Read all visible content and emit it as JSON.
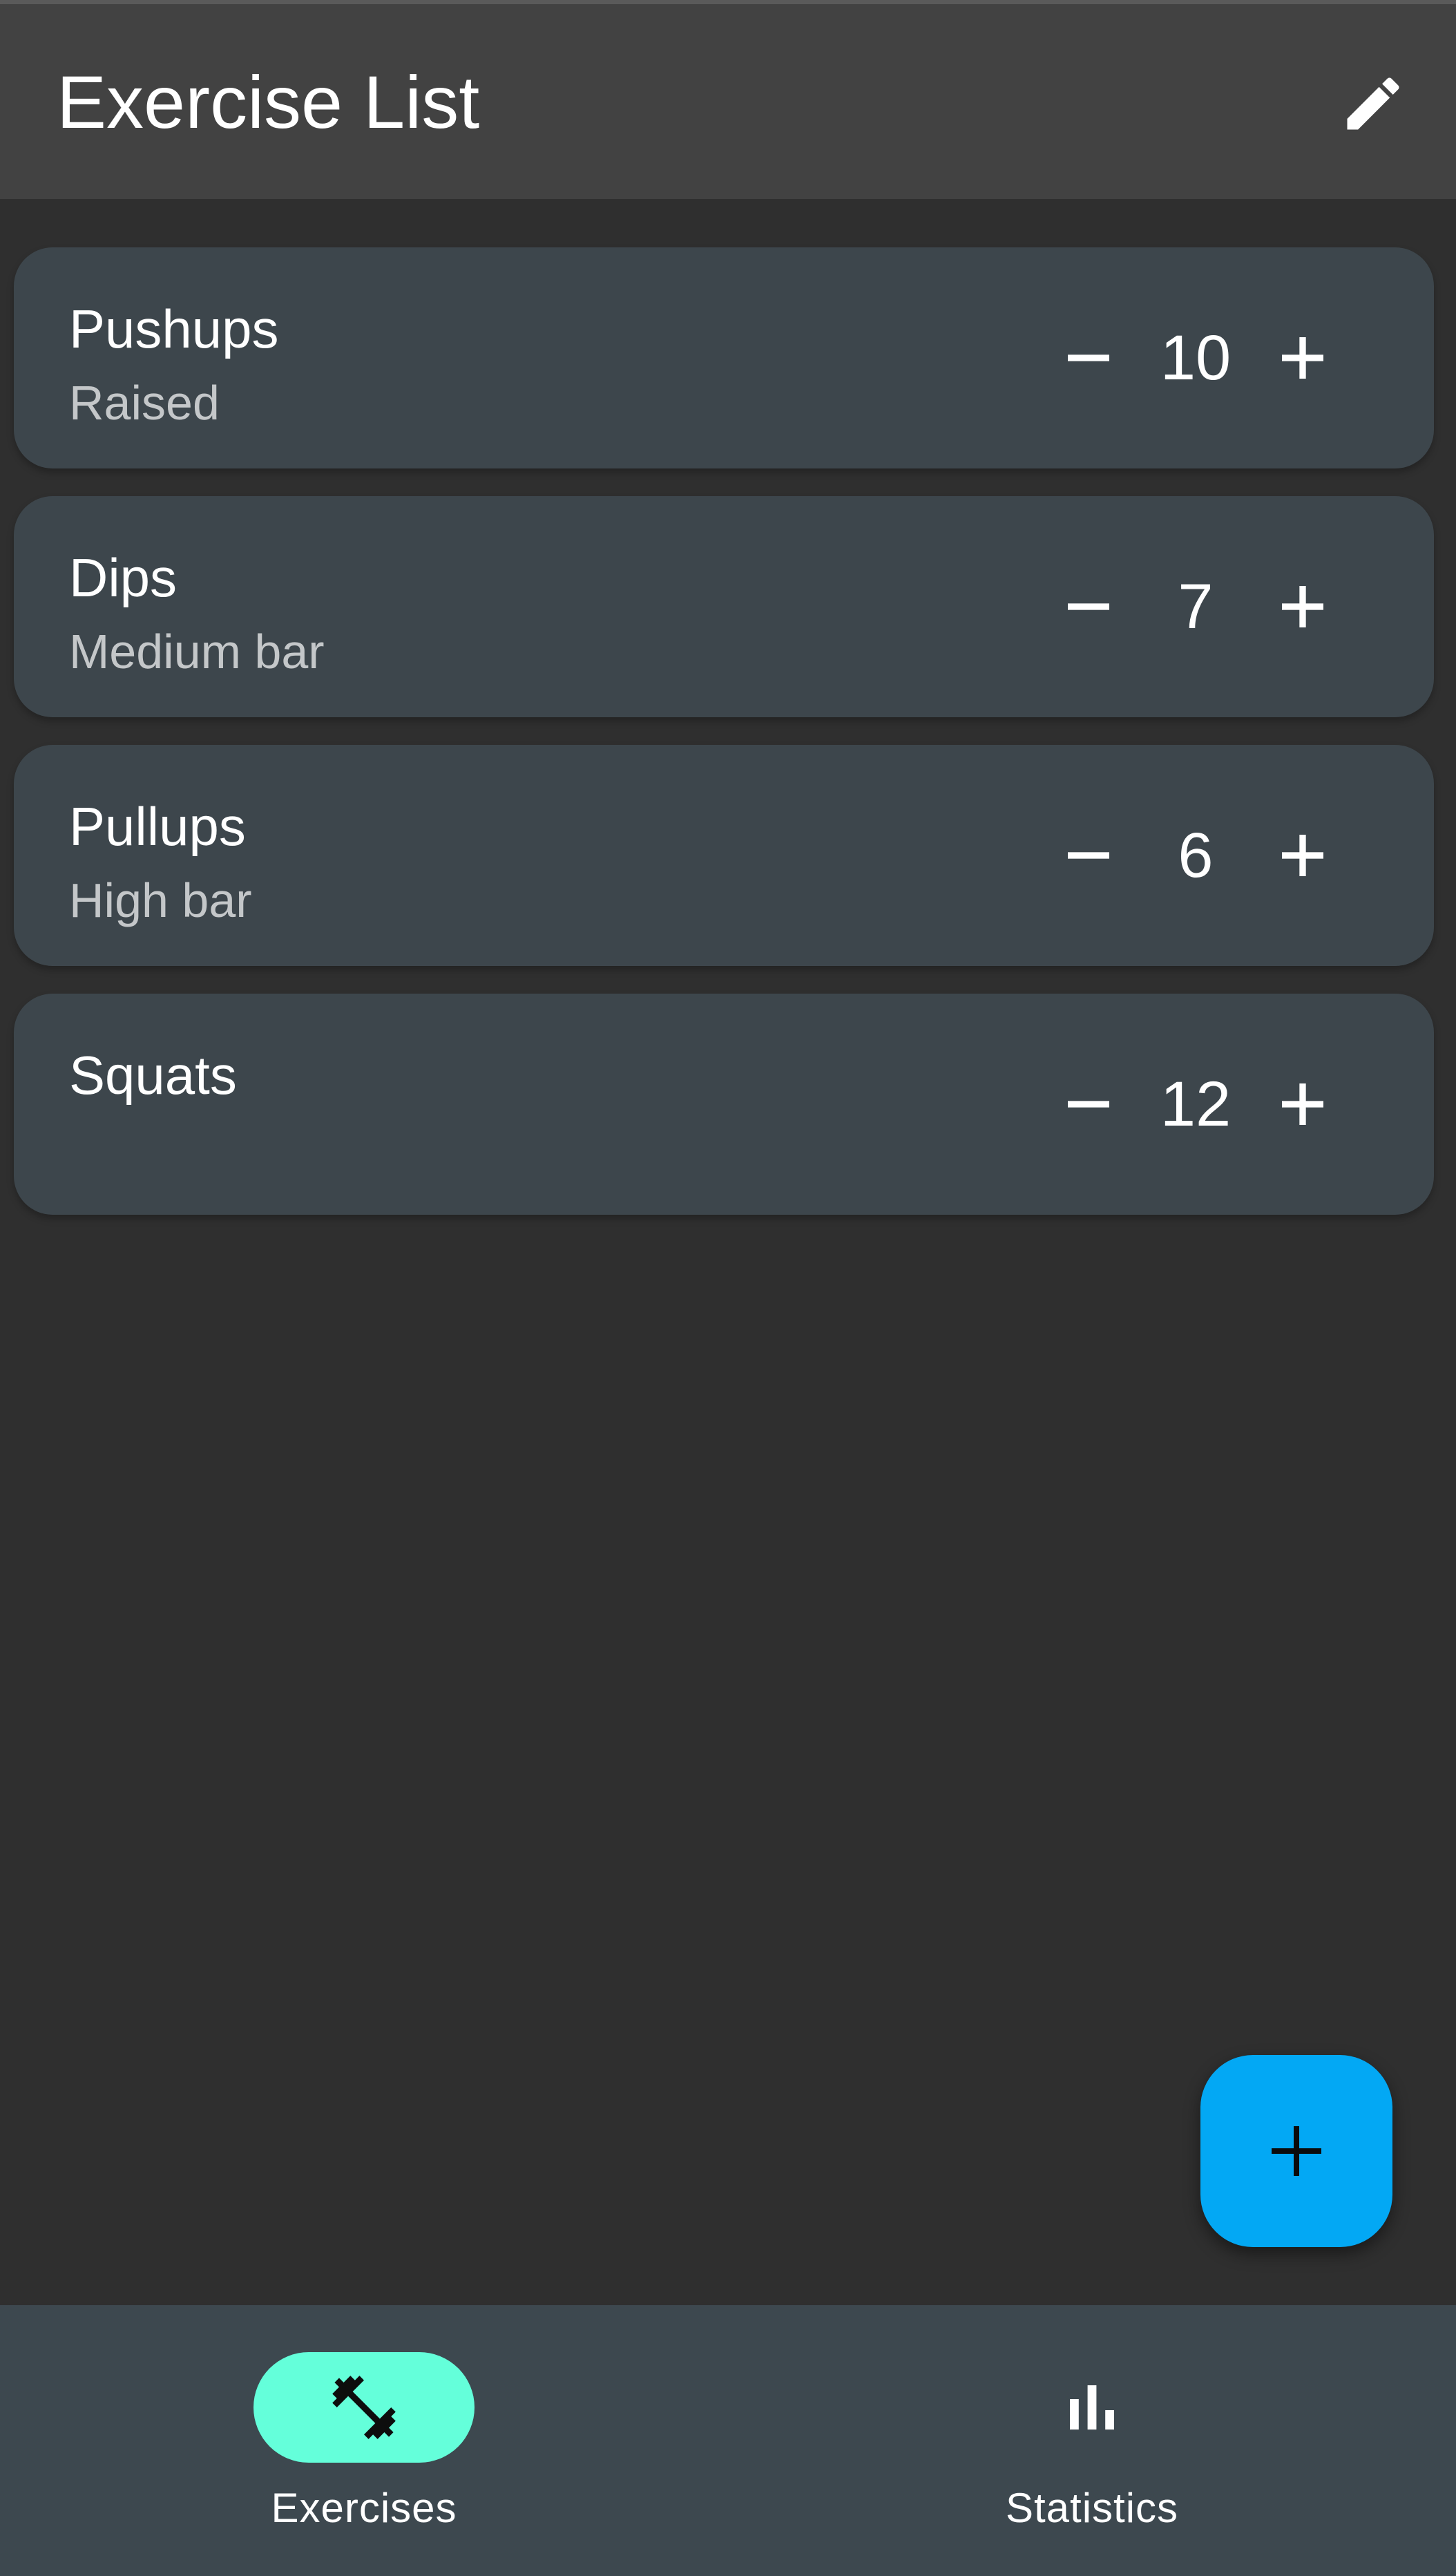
{
  "appbar": {
    "title": "Exercise List",
    "edit_icon": "pencil-icon"
  },
  "exercises": [
    {
      "name": "Pushups",
      "subtitle": "Raised",
      "count": "10"
    },
    {
      "name": "Dips",
      "subtitle": "Medium bar",
      "count": "7"
    },
    {
      "name": "Pullups",
      "subtitle": "High bar",
      "count": "6"
    },
    {
      "name": "Squats",
      "subtitle": "",
      "count": "12"
    }
  ],
  "fab": {
    "icon": "plus-icon"
  },
  "bottom_nav": {
    "items": [
      {
        "label": "Exercises",
        "icon": "dumbbell-icon",
        "active": true
      },
      {
        "label": "Statistics",
        "icon": "bar-chart-icon",
        "active": false
      }
    ]
  },
  "colors": {
    "background": "#2f2f2f",
    "appbar": "#424242",
    "card": "#3d464c",
    "fab": "#03a8f4",
    "nav_active_pill": "#64ffda",
    "bottom_nav": "#3d484f"
  }
}
